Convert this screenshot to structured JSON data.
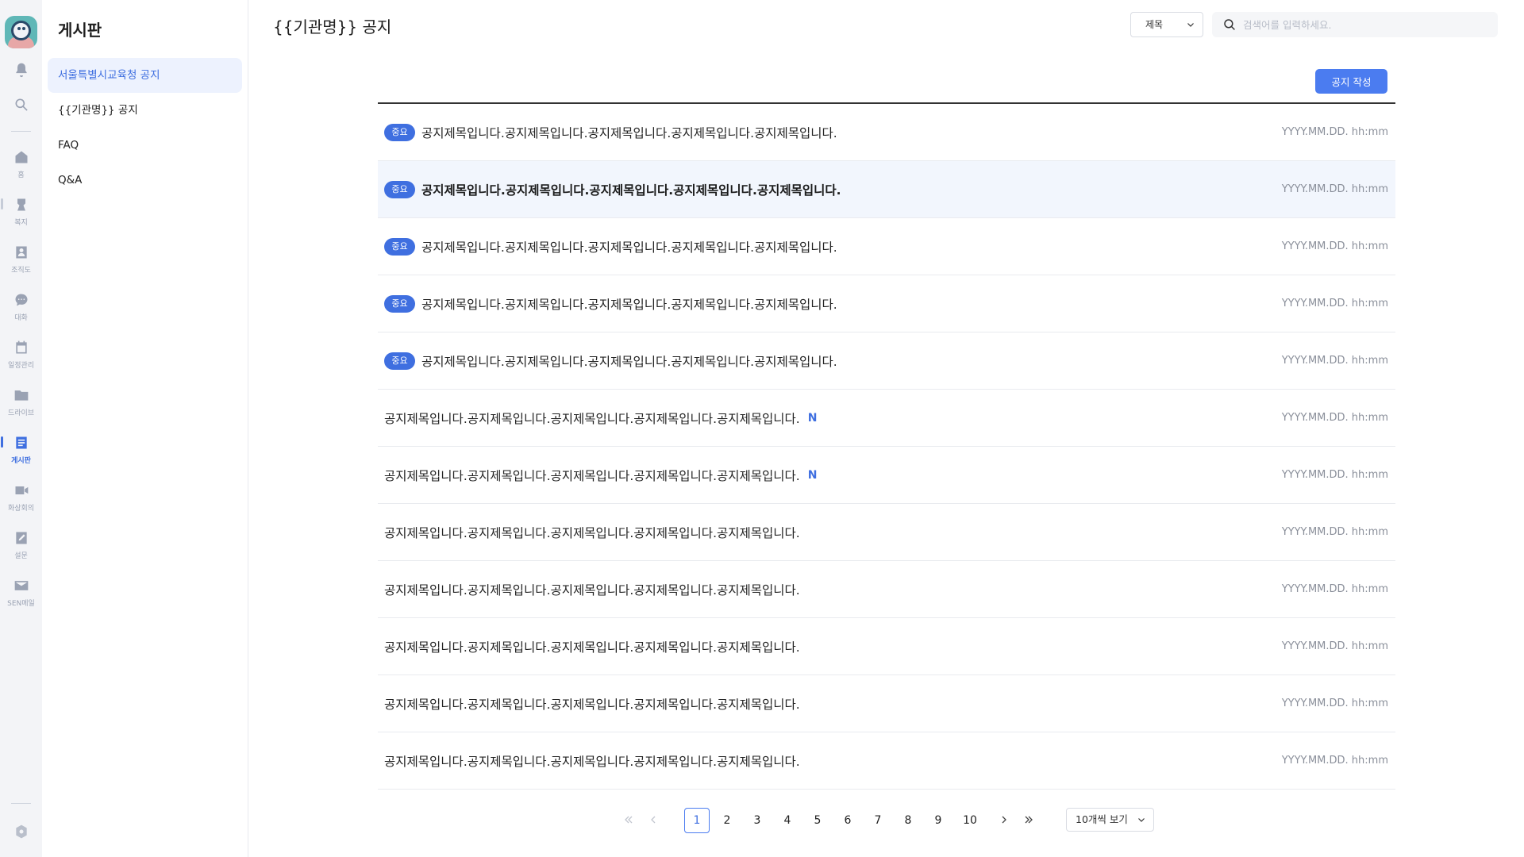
{
  "rail": {
    "items": [
      {
        "icon": "bell-icon",
        "label": ""
      },
      {
        "icon": "search-icon",
        "label": ""
      },
      {
        "icon": "home-icon",
        "label": "홈"
      },
      {
        "icon": "welfare-icon",
        "label": "복지"
      },
      {
        "icon": "org-chart-icon",
        "label": "조직도"
      },
      {
        "icon": "chat-icon",
        "label": "대화"
      },
      {
        "icon": "calendar-icon",
        "label": "일정관리"
      },
      {
        "icon": "folder-icon",
        "label": "드라이브"
      },
      {
        "icon": "board-icon",
        "label": "게시판"
      },
      {
        "icon": "video-icon",
        "label": "화상회의"
      },
      {
        "icon": "survey-icon",
        "label": "설문"
      },
      {
        "icon": "mail-icon",
        "label": "SEN메일"
      }
    ],
    "settings_icon": "gear-icon",
    "active_color": "#3f6fe0"
  },
  "sidebar": {
    "title": "게시판",
    "items": [
      {
        "label": "서울특별시교육청 공지"
      },
      {
        "label": "{{기관명}} 공지"
      },
      {
        "label": "FAQ"
      },
      {
        "label": "Q&A"
      }
    ]
  },
  "main": {
    "title": "{{기관명}} 공지",
    "filter_select": "제목",
    "search_placeholder": "검색어를 입력하세요.",
    "write_button": "공지 작성",
    "badge_label": "중요",
    "new_label": "N",
    "rows": [
      {
        "title": "공지제목입니다.공지제목입니다.공지제목입니다.공지제목입니다.공지제목입니다.",
        "date": "YYYY.MM.DD. hh:mm"
      },
      {
        "title": "공지제목입니다.공지제목입니다.공지제목입니다.공지제목입니다.공지제목입니다.",
        "date": "YYYY.MM.DD. hh:mm"
      },
      {
        "title": "공지제목입니다.공지제목입니다.공지제목입니다.공지제목입니다.공지제목입니다.",
        "date": "YYYY.MM.DD. hh:mm"
      },
      {
        "title": "공지제목입니다.공지제목입니다.공지제목입니다.공지제목입니다.공지제목입니다.",
        "date": "YYYY.MM.DD. hh:mm"
      },
      {
        "title": "공지제목입니다.공지제목입니다.공지제목입니다.공지제목입니다.공지제목입니다.",
        "date": "YYYY.MM.DD. hh:mm"
      },
      {
        "title": "공지제목입니다.공지제목입니다.공지제목입니다.공지제목입니다.공지제목입니다.",
        "date": "YYYY.MM.DD. hh:mm"
      },
      {
        "title": "공지제목입니다.공지제목입니다.공지제목입니다.공지제목입니다.공지제목입니다.",
        "date": "YYYY.MM.DD. hh:mm"
      },
      {
        "title": "공지제목입니다.공지제목입니다.공지제목입니다.공지제목입니다.공지제목입니다.",
        "date": "YYYY.MM.DD. hh:mm"
      },
      {
        "title": "공지제목입니다.공지제목입니다.공지제목입니다.공지제목입니다.공지제목입니다.",
        "date": "YYYY.MM.DD. hh:mm"
      },
      {
        "title": "공지제목입니다.공지제목입니다.공지제목입니다.공지제목입니다.공지제목입니다.",
        "date": "YYYY.MM.DD. hh:mm"
      },
      {
        "title": "공지제목입니다.공지제목입니다.공지제목입니다.공지제목입니다.공지제목입니다.",
        "date": "YYYY.MM.DD. hh:mm"
      },
      {
        "title": "공지제목입니다.공지제목입니다.공지제목입니다.공지제목입니다.공지제목입니다.",
        "date": "YYYY.MM.DD. hh:mm"
      }
    ]
  },
  "pagination": {
    "pages": [
      "1",
      "2",
      "3",
      "4",
      "5",
      "6",
      "7",
      "8",
      "9",
      "10"
    ],
    "current": "1",
    "per_page": "10개씩 보기"
  },
  "colors": {
    "accent": "#4b7cf0",
    "highlight_row": "#f2f6fd"
  }
}
